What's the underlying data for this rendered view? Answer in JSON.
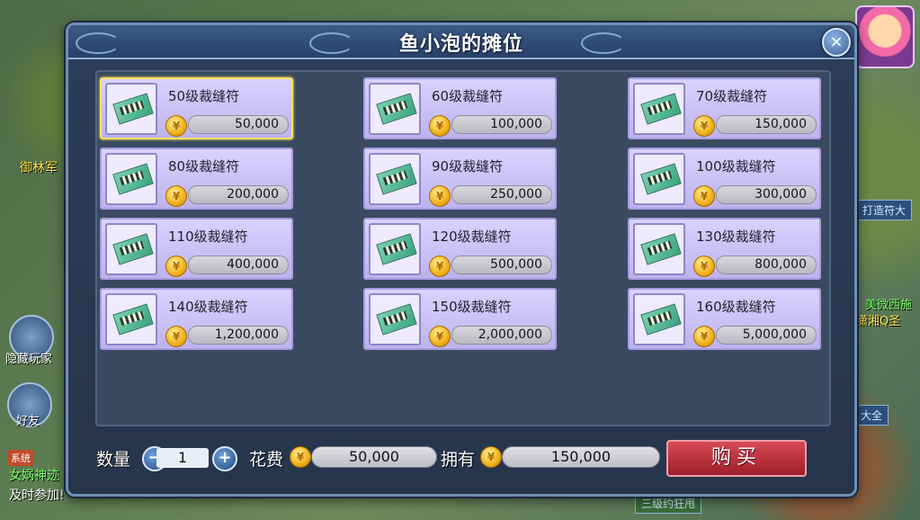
{
  "background": {
    "left_label": "御林军",
    "hide_players": "隐藏玩家",
    "friends": "好友",
    "system_tag": "系统",
    "chat_line1": "女娲神迹",
    "chat_line2": "及时参加!",
    "right_tag1": "打造符大",
    "right_name": "美微西施",
    "right_name2": "潇湘Q圣",
    "right_tag2": "大全",
    "bottom_tag": "三级约狂甩"
  },
  "window": {
    "title": "鱼小泡的摊位",
    "close_label": "×"
  },
  "items": [
    {
      "name": "50级裁缝符",
      "price": "50,000",
      "selected": true
    },
    {
      "name": "60级裁缝符",
      "price": "100,000"
    },
    {
      "name": "70级裁缝符",
      "price": "150,000"
    },
    {
      "name": "80级裁缝符",
      "price": "200,000"
    },
    {
      "name": "90级裁缝符",
      "price": "250,000"
    },
    {
      "name": "100级裁缝符",
      "price": "300,000"
    },
    {
      "name": "110级裁缝符",
      "price": "400,000"
    },
    {
      "name": "120级裁缝符",
      "price": "500,000"
    },
    {
      "name": "130级裁缝符",
      "price": "800,000"
    },
    {
      "name": "140级裁缝符",
      "price": "1,200,000"
    },
    {
      "name": "150级裁缝符",
      "price": "2,000,000"
    },
    {
      "name": "160级裁缝符",
      "price": "5,000,000"
    }
  ],
  "bottom": {
    "quantity_label": "数量",
    "minus": "−",
    "quantity": "1",
    "plus": "+",
    "cost_label": "花费",
    "cost": "50,000",
    "owned_label": "拥有",
    "owned": "150,000",
    "buy_label": "购买"
  },
  "icons": {
    "coin": "gold-coin-icon",
    "item": "tailor-talisman-icon",
    "close": "close-icon"
  }
}
